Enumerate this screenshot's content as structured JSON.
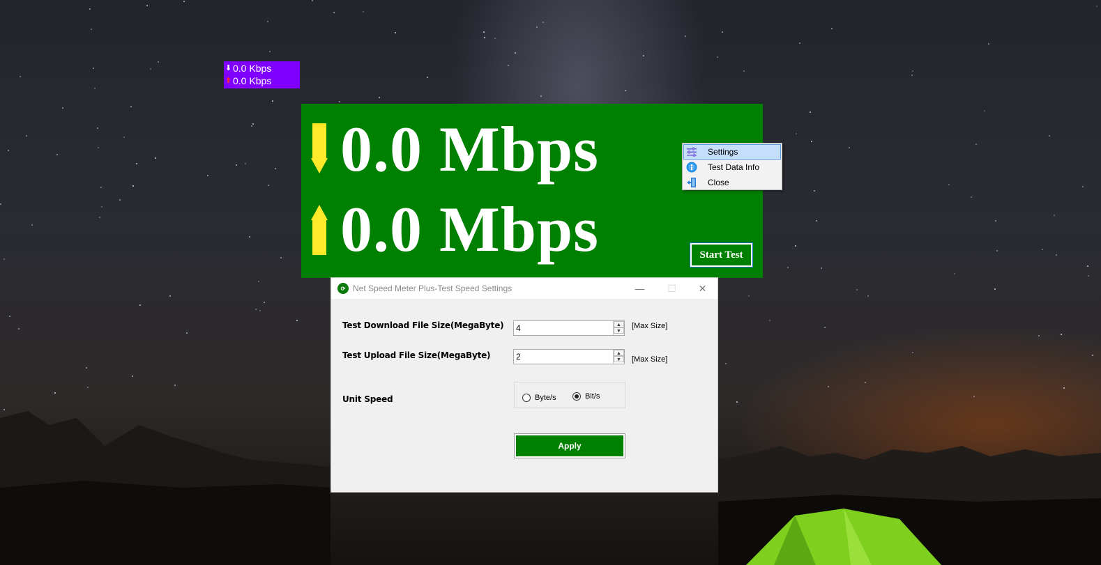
{
  "mini_meter": {
    "download_arrow": "⬇",
    "download": "0.0 Kbps",
    "upload_arrow": "⬆",
    "upload": "0.0 Kbps"
  },
  "big_meter": {
    "download": "0.0 Mbps",
    "upload": "0.0 Mbps",
    "start_test_label": "Start Test",
    "arrow_color": "#ffe928",
    "background_color": "#008000"
  },
  "context_menu": {
    "items": [
      {
        "label": "Settings",
        "icon": "sliders-icon"
      },
      {
        "label": "Test Data Info",
        "icon": "info-icon"
      },
      {
        "label": "Close",
        "icon": "exit-door-icon"
      }
    ]
  },
  "settings_window": {
    "title": "Net Speed Meter Plus-Test Speed Settings",
    "download_label": "Test Download File Size(MegaByte)",
    "download_value": "4",
    "download_max": "[Max Size]",
    "upload_label": "Test Upload File Size(MegaByte)",
    "upload_value": "2",
    "upload_max": "[Max Size]",
    "unit_label": "Unit Speed",
    "unit_options": [
      "Byte/s",
      "Bit/s"
    ],
    "unit_selected": "Bit/s",
    "apply_label": "Apply"
  }
}
